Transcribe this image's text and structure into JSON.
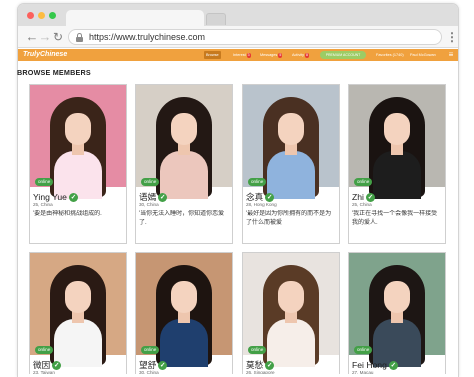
{
  "browser": {
    "url": "https://www.trulychinese.com"
  },
  "site": {
    "logo": "TrulyChinese",
    "nav": [
      {
        "label": "Browse",
        "count": "",
        "active": true
      },
      {
        "label": "Interest",
        "count": "3"
      },
      {
        "label": "Messages",
        "count": "5"
      },
      {
        "label": "Activity",
        "count": "8"
      }
    ],
    "premium_label": "PREMIUM ACCOUNT",
    "credits": "Favorites (1740)",
    "username": "Paul McGowan"
  },
  "page": {
    "section_title": "BROWSE MEMBERS"
  },
  "online_label": "online",
  "colors": {
    "header": "#f0a13e",
    "online": "#43a047",
    "premium": "#9ccc65"
  },
  "members": [
    {
      "name": "Ying Yue",
      "meta": "25, China",
      "bio": "'要是由神秘和挑战组成的.",
      "photo": {
        "bg": "#e58ca4",
        "hair": "#3a2419",
        "top": "#fbe3ec"
      }
    },
    {
      "name": "语嫣",
      "meta": "30, China",
      "bio": "'当你无法入睡时，你知道你恋爱了.",
      "photo": {
        "bg": "#d6cfc6",
        "hair": "#231814",
        "top": "#ecc7bd"
      }
    },
    {
      "name": "念真",
      "meta": "28, Hong Kong",
      "bio": "'最好是因为你所拥有的而不是为了什么而被爱",
      "photo": {
        "bg": "#b9c3cc",
        "hair": "#4a3022",
        "top": "#8fb3dd"
      }
    },
    {
      "name": "Zhi",
      "meta": "25, China",
      "bio": "'我正在寻找一个会像我一样接受我的爱人.",
      "photo": {
        "bg": "#b9b7b1",
        "hair": "#1a1311",
        "top": "#1d1d1d"
      }
    },
    {
      "name": "微因",
      "meta": "23, Taiwan",
      "bio": "",
      "photo": {
        "bg": "#d6a884",
        "hair": "#2a1a14",
        "top": "#f5f5f5"
      }
    },
    {
      "name": "望舒",
      "meta": "30, China",
      "bio": "",
      "photo": {
        "bg": "#c69673",
        "hair": "#1e1410",
        "top": "#1f3f6e"
      }
    },
    {
      "name": "莫愁",
      "meta": "26, Singapore",
      "bio": "",
      "photo": {
        "bg": "#e8e3df",
        "hair": "#5a3b26",
        "top": "#f6eee9"
      }
    },
    {
      "name": "Fei Hong",
      "meta": "27, Macau",
      "bio": "",
      "photo": {
        "bg": "#7fa38c",
        "hair": "#1d1614",
        "top": "#3a4a5a"
      }
    }
  ]
}
